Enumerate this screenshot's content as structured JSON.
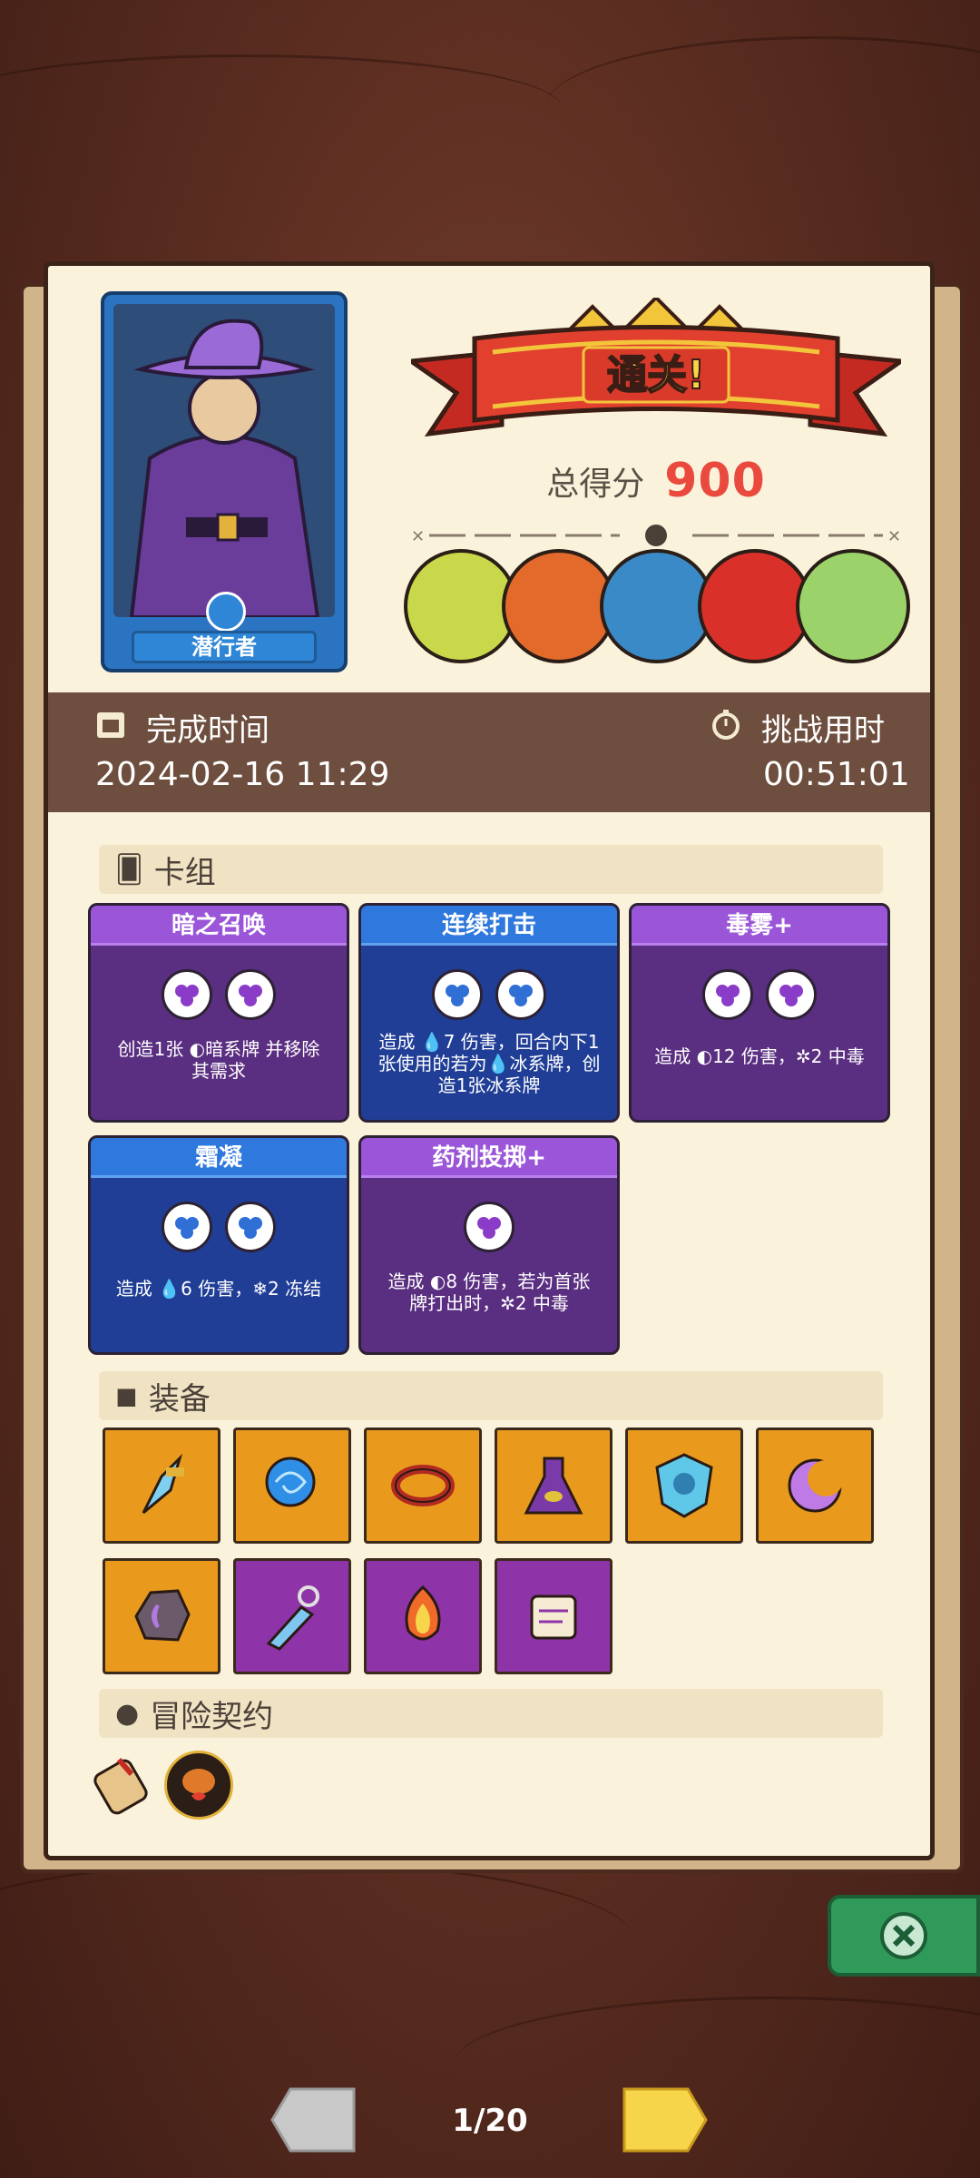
{
  "result": {
    "banner_text": "通关!",
    "score_label": "总得分",
    "score_value": "900"
  },
  "character": {
    "name": "潜行者"
  },
  "timebar": {
    "finish_label": "完成时间",
    "finish_value": "2024-02-16 11:29",
    "challenge_label": "挑战用时",
    "challenge_value": "00:51:01"
  },
  "bosses": [
    "skeleton-dragon",
    "fire-ogre",
    "armored-knight",
    "red-hat-clown",
    "forest-elf"
  ],
  "deck": {
    "title": "卡组",
    "cards": [
      {
        "title": "暗之召唤",
        "theme": "purple",
        "orbs": 2,
        "line1": "创造1张 ◐暗系牌 并移除",
        "line2": "其需求",
        "line3": ""
      },
      {
        "title": "连续打击",
        "theme": "blue",
        "orbs": 2,
        "line1": "造成 💧7 伤害，回合内下1",
        "line2": "张使用的若为💧冰系牌，创",
        "line3": "造1张冰系牌"
      },
      {
        "title": "毒雾+",
        "theme": "purple",
        "orbs": 2,
        "line1": "造成 ◐12 伤害，✲2 中毒",
        "line2": "",
        "line3": ""
      },
      {
        "title": "霜凝",
        "theme": "blue",
        "orbs": 2,
        "line1": "造成 💧6 伤害，❄2 冻结",
        "line2": "",
        "line3": ""
      },
      {
        "title": "药剂投掷+",
        "theme": "purple",
        "orbs": 1,
        "line1": "造成 ◐8 伤害，若为首张",
        "line2": "牌打出时，✲2 中毒",
        "line3": ""
      }
    ]
  },
  "equipment": {
    "title": "装备",
    "items": [
      {
        "icon": "crystal-dagger-icon",
        "color": "orange"
      },
      {
        "icon": "blue-orb-staff-icon",
        "color": "orange"
      },
      {
        "icon": "spiked-collar-icon",
        "color": "orange"
      },
      {
        "icon": "eye-potion-flask-icon",
        "color": "orange"
      },
      {
        "icon": "ice-shield-icon",
        "color": "orange"
      },
      {
        "icon": "purple-moon-icon",
        "color": "orange"
      },
      {
        "icon": "moon-stone-icon",
        "color": "orange"
      },
      {
        "icon": "ice-blade-icon",
        "color": "violet"
      },
      {
        "icon": "fire-gem-icon",
        "color": "violet"
      },
      {
        "icon": "magic-scroll-icon",
        "color": "violet"
      }
    ]
  },
  "contract": {
    "title": "冒险契约",
    "items": [
      "scroll-contract-icon",
      "roast-chicken-heart-icon"
    ]
  },
  "pager": {
    "indicator": "1/20"
  },
  "colors": {
    "panel": "#fbf2dc",
    "score": "#e94a3d",
    "banner_red": "#d93a2a",
    "card_purple": "#5a2e80",
    "card_blue": "#203e96",
    "equip_orange": "#e99a1c",
    "equip_violet": "#8e34a8",
    "close_green": "#2f9a5a"
  }
}
